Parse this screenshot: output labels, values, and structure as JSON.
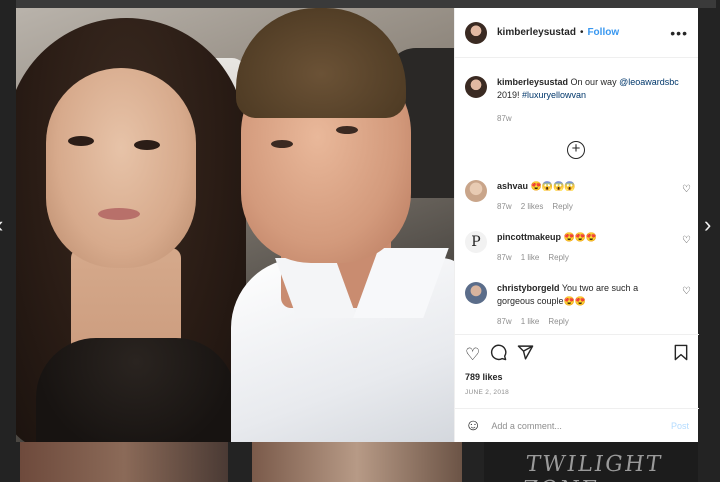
{
  "post": {
    "username": "kimberleysustad",
    "follow_label": "Follow",
    "more_label": "•••",
    "caption_username": "kimberleysustad",
    "caption_text_1": " On our way ",
    "caption_mention": "@leoawardsbc",
    "caption_text_2": " 2019! ",
    "caption_hashtag": "#luxuryellowvan",
    "caption_time": "87w",
    "likes": "789 likes",
    "date": "JUNE 2, 2018",
    "add_comment_placeholder": "Add a comment...",
    "post_label": "Post"
  },
  "comments": [
    {
      "username": "ashvau",
      "text": " 😍😱😱😱",
      "time": "87w",
      "likes": "2 likes",
      "reply": "Reply",
      "avatar_color": "#c9a58a"
    },
    {
      "username": "pincottmakeup",
      "text": " 😍😍😍",
      "time": "87w",
      "likes": "1 like",
      "reply": "Reply",
      "avatar_letter": "P",
      "avatar_color": "#f2f2f2"
    },
    {
      "username": "christyborgeld",
      "text": " You two are such a gorgeous couple😍😍",
      "time": "87w",
      "likes": "1 like",
      "reply": "Reply",
      "avatar_color": "#5b6d8a"
    }
  ],
  "nav": {
    "prev": "‹",
    "next": "›"
  },
  "background": {
    "tile_text": "TWILIGHT ZONE"
  },
  "icons": {
    "heart": "heart-icon",
    "comment": "comment-icon",
    "share": "share-icon",
    "save": "bookmark-icon",
    "emoji": "smile-icon",
    "add": "plus-circle-icon"
  },
  "colors": {
    "link": "#00376b",
    "follow": "#3897f0",
    "post_disabled": "#b3dbff"
  }
}
